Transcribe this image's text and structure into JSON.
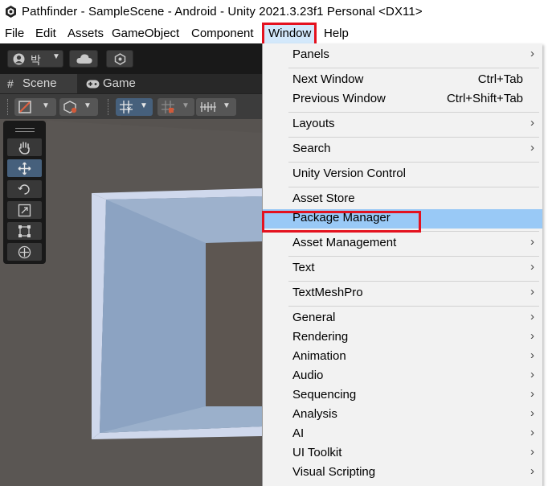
{
  "window": {
    "title": "Pathfinder - SampleScene - Android - Unity 2021.3.23f1 Personal <DX11>"
  },
  "menubar": {
    "items": [
      {
        "label": "File"
      },
      {
        "label": "Edit"
      },
      {
        "label": "Assets"
      },
      {
        "label": "GameObject"
      },
      {
        "label": "Component"
      },
      {
        "label": "Window"
      },
      {
        "label": "Help"
      }
    ]
  },
  "toolbar": {
    "account_label": "박"
  },
  "tabs": [
    {
      "label": "Scene"
    },
    {
      "label": "Game"
    }
  ],
  "window_menu": {
    "items": [
      {
        "label": "Panels",
        "submenu": true
      },
      {
        "label": "Next Window",
        "shortcut": "Ctrl+Tab"
      },
      {
        "label": "Previous Window",
        "shortcut": "Ctrl+Shift+Tab"
      },
      {
        "label": "Layouts",
        "submenu": true
      },
      {
        "label": "Search",
        "submenu": true
      },
      {
        "label": "Unity Version Control"
      },
      {
        "label": "Asset Store"
      },
      {
        "label": "Package Manager",
        "highlighted": true
      },
      {
        "label": "Asset Management",
        "submenu": true
      },
      {
        "label": "Text",
        "submenu": true
      },
      {
        "label": "TextMeshPro",
        "submenu": true
      },
      {
        "label": "General",
        "submenu": true
      },
      {
        "label": "Rendering",
        "submenu": true
      },
      {
        "label": "Animation",
        "submenu": true
      },
      {
        "label": "Audio",
        "submenu": true
      },
      {
        "label": "Sequencing",
        "submenu": true
      },
      {
        "label": "Analysis",
        "submenu": true
      },
      {
        "label": "AI",
        "submenu": true
      },
      {
        "label": "UI Toolkit",
        "submenu": true
      },
      {
        "label": "Visual Scripting",
        "submenu": true
      }
    ],
    "submenu_arrow": "›"
  },
  "colors": {
    "highlight_box": "#e4121f",
    "menu_highlight": "#99c9f6",
    "editor_dark": "#191919",
    "scene_bg": "#575350",
    "mesh": "#8fa6c4"
  }
}
